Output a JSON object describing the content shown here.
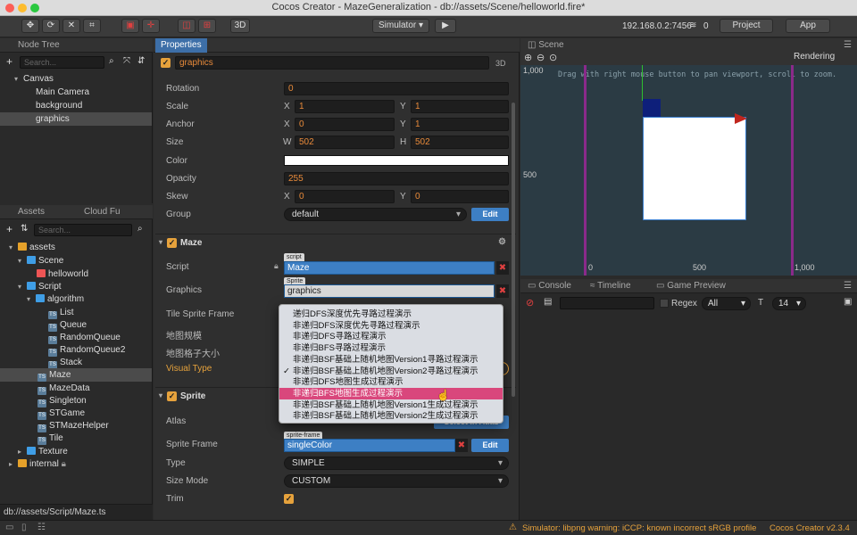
{
  "window": {
    "title": "Cocos Creator - MazeGeneralization - db://assets/Scene/helloworld.fire*"
  },
  "toolbar": {
    "btn_move": "✥",
    "btn_rotate": "⟳",
    "btn_scale": "✕",
    "btn_rect": "⌗",
    "btn_3d": "3D",
    "simulator": "Simulator ▾",
    "play": "▶",
    "ip": "192.168.0.2:7456",
    "wifi_count": "0",
    "project": "Project",
    "app": "App"
  },
  "node_tree": {
    "title": "Node Tree",
    "search_placeholder": "Search...",
    "items": [
      {
        "label": "Canvas"
      },
      {
        "label": "Main Camera"
      },
      {
        "label": "background"
      },
      {
        "label": "graphics"
      }
    ]
  },
  "assets": {
    "tabs": [
      "Assets",
      "Cloud Fu"
    ],
    "search_placeholder": "Search...",
    "items": [
      {
        "label": "assets"
      },
      {
        "label": "Scene"
      },
      {
        "label": "helloworld"
      },
      {
        "label": "Script"
      },
      {
        "label": "algorithm"
      },
      {
        "label": "List"
      },
      {
        "label": "Queue"
      },
      {
        "label": "RandomQueue"
      },
      {
        "label": "RandomQueue2"
      },
      {
        "label": "Stack"
      },
      {
        "label": "Maze"
      },
      {
        "label": "MazeData"
      },
      {
        "label": "Singleton"
      },
      {
        "label": "STGame"
      },
      {
        "label": "STMazeHelper"
      },
      {
        "label": "Tile"
      },
      {
        "label": "Texture"
      },
      {
        "label": "internal"
      }
    ],
    "path": "db://assets/Script/Maze.ts"
  },
  "properties": {
    "title": "Properties",
    "node_name": "graphics",
    "badge_3d": "3D",
    "rotation": {
      "label": "Rotation",
      "value": "0"
    },
    "scale": {
      "label": "Scale",
      "x_label": "X",
      "x": "1",
      "y_label": "Y",
      "y": "1"
    },
    "anchor": {
      "label": "Anchor",
      "x_label": "X",
      "x": "0",
      "y_label": "Y",
      "y": "1"
    },
    "size": {
      "label": "Size",
      "w_label": "W",
      "w": "502",
      "h_label": "H",
      "h": "502"
    },
    "color": {
      "label": "Color",
      "value": "#ffffff"
    },
    "opacity": {
      "label": "Opacity",
      "value": "255"
    },
    "skew": {
      "label": "Skew",
      "x_label": "X",
      "x": "0",
      "y_label": "Y",
      "y": "0"
    },
    "group": {
      "label": "Group",
      "value": "default",
      "edit": "Edit"
    },
    "maze": {
      "title": "Maze",
      "script_label": "Script",
      "script_tag": "script",
      "script_value": "Maze",
      "graphics_label": "Graphics",
      "graphics_tag": "Sprite",
      "graphics_value": "graphics",
      "tile_frame_label": "Tile Sprite Frame",
      "map_size_label": "地图规模",
      "grid_size_label": "地图格子大小",
      "visual_type_label": "Visual Type"
    },
    "sprite": {
      "title": "Sprite",
      "atlas_label": "Atlas",
      "atlas_btn": "Select In Atlas",
      "frame_label": "Sprite Frame",
      "frame_tag": "sprite-frame",
      "frame_value": "singleColor",
      "edit": "Edit",
      "type_label": "Type",
      "type_value": "SIMPLE",
      "size_mode_label": "Size Mode",
      "size_mode_value": "CUSTOM",
      "trim_label": "Trim"
    }
  },
  "dropdown": {
    "options": [
      "递归DFS深度优先寻路过程演示",
      "非递归DFS深度优先寻路过程演示",
      "非递归DFS寻路过程演示",
      "非递归BFS寻路过程演示",
      "非递归BSF基础上随机地图Version1寻路过程演示",
      "非递归BSF基础上随机地图Version2寻路过程演示",
      "非递归DFS地图生成过程演示",
      "非递归BFS地图生成过程演示",
      "非递归BSF基础上随机地图Version1生成过程演示",
      "非递归BSF基础上随机地图Version2生成过程演示"
    ],
    "checked_index": 5,
    "highlighted_index": 7
  },
  "scene": {
    "title": "Scene",
    "rendering": "Rendering",
    "hint": "Drag with right mouse button to pan viewport, scroll to zoom.",
    "y_labels": [
      "1,000",
      "500"
    ],
    "x_labels": [
      "0",
      "500",
      "1,000"
    ]
  },
  "console": {
    "tabs": [
      "Console",
      "Timeline",
      "Game Preview"
    ],
    "regex": "Regex",
    "filter": "All",
    "font_size": "14"
  },
  "status": {
    "warning": "Simulator: libpng warning: iCCP: known incorrect sRGB profile",
    "version": "Cocos Creator v2.3.4"
  },
  "colors": {
    "accent": "#3d7fc4",
    "highlight": "#d9477c",
    "warning": "#e6a23c"
  }
}
